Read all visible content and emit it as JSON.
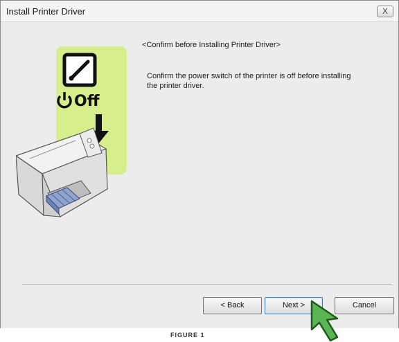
{
  "window": {
    "title": "Install Printer Driver",
    "close_label": "X"
  },
  "main": {
    "heading": "<Confirm before Installing Printer Driver>",
    "message": "Confirm the power switch of the printer is off before installing the printer driver.",
    "illustration": {
      "power_label": "Off",
      "panel_color": "#d7ee8c",
      "icons": [
        "power-switch-icon",
        "power-symbol-icon",
        "down-arrow-icon",
        "printer-icon"
      ]
    }
  },
  "buttons": {
    "back": "< Back",
    "next": "Next >",
    "cancel": "Cancel"
  },
  "cursor": {
    "icon": "green-arrow-cursor-icon",
    "color": "#5ab552"
  },
  "caption": "FIGURE 1"
}
